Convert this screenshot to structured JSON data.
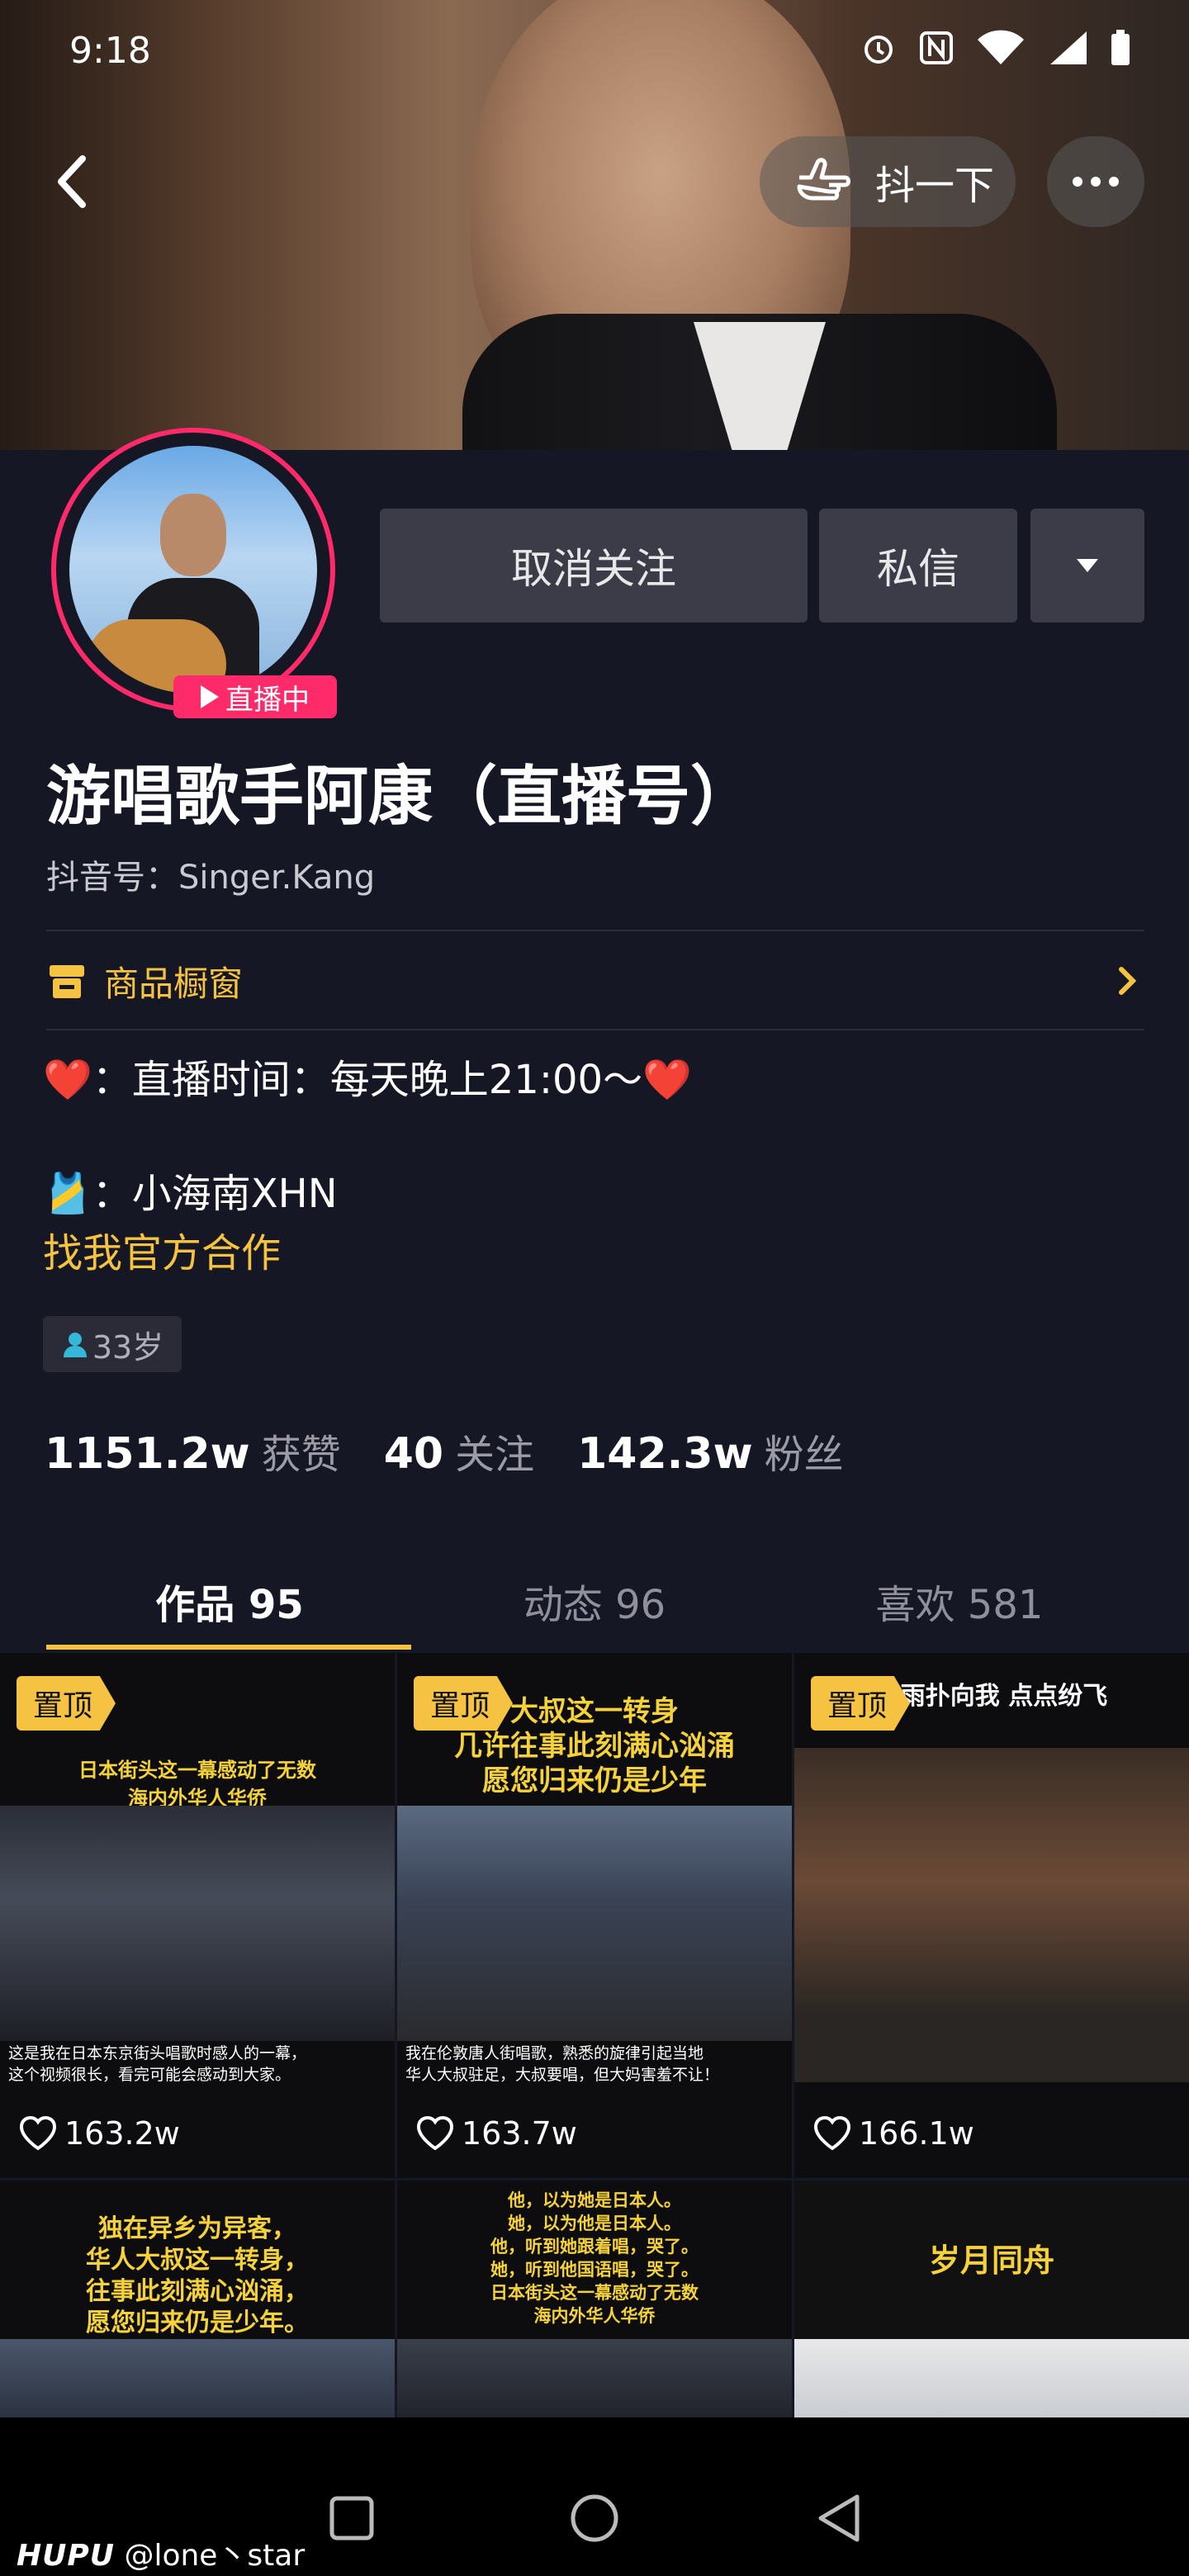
{
  "status_bar": {
    "time": "9:18",
    "icons": [
      "alarm-icon",
      "nfc-icon",
      "wifi-icon",
      "signal-icon",
      "battery-icon"
    ]
  },
  "header": {
    "shake_label": "抖一下"
  },
  "profile": {
    "live_badge": "直播中",
    "unfollow_label": "取消关注",
    "message_label": "私信",
    "name": "游唱歌手阿康（直播号）",
    "douyin_id": "抖音号：Singer.Kang",
    "shop_label": "商品橱窗",
    "bio_line1": "❤️：直播时间：每天晚上21:00～❤️",
    "bio_line2": "🎽：小海南XHN",
    "coop_link": "找我官方合作",
    "age": "33岁",
    "likes_num": "1151.2w",
    "likes_label": "获赞",
    "following_num": "40",
    "following_label": "关注",
    "followers_num": "142.3w",
    "followers_label": "粉丝"
  },
  "tabs": [
    {
      "label": "作品 95",
      "active": true
    },
    {
      "label": "动态 96",
      "active": false
    },
    {
      "label": "喜欢 581",
      "active": false
    }
  ],
  "videos": [
    {
      "pinned": "置顶",
      "likes": "163.2w",
      "caption_top": "日本街头这一幕感动了无数\n海内外华人华侨",
      "caption_bottom": "这是我在日本东京街头唱歌时感人的一幕，\n这个视频很长，看完可能会感动到大家。"
    },
    {
      "pinned": "置顶",
      "likes": "163.7w",
      "caption_top": "大叔这一转身\n几许往事此刻满心汹涌\n愿您归来仍是少年",
      "caption_bottom": "我在伦敦唐人街唱歌，熟悉的旋律引起当地\n华人大叔驻足，大叔要唱，但大妈害羞不让！"
    },
    {
      "pinned": "置顶",
      "likes": "166.1w",
      "caption_top": "冷雨扑向我 点点纷飞",
      "caption_bottom": ""
    },
    {
      "caption_top": "独在异乡为异客，\n华人大叔这一转身，\n往事此刻满心汹涌，\n愿您归来仍是少年。"
    },
    {
      "caption_top": "他，以为她是日本人。\n她，以为他是日本人。\n他，听到她跟着唱，哭了。\n她，听到他国语唱，哭了。\n日本街头这一幕感动了无数\n海内外华人华侨"
    },
    {
      "caption_top": "岁月同舟"
    }
  ],
  "watermark": {
    "brand": "HUPU",
    "user": "@lone丶star"
  },
  "colors": {
    "accent": "#f5c242",
    "live": "#ff2a6a",
    "background": "#161724"
  }
}
